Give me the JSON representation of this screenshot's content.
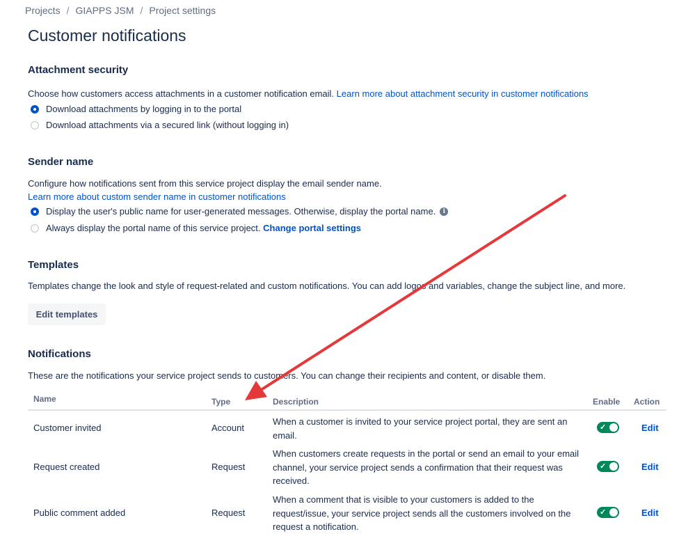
{
  "breadcrumb": {
    "items": [
      "Projects",
      "GIAPPS JSM",
      "Project settings"
    ],
    "separator": "/"
  },
  "page": {
    "title": "Customer notifications"
  },
  "attachment_security": {
    "heading": "Attachment security",
    "description": "Choose how customers access attachments in a customer notification email.",
    "learn_more": "Learn more about attachment security in customer notifications",
    "options": [
      {
        "label": "Download attachments by logging in to the portal",
        "selected": true
      },
      {
        "label": "Download attachments via a secured link (without logging in)",
        "selected": false
      }
    ]
  },
  "sender_name": {
    "heading": "Sender name",
    "description": "Configure how notifications sent from this service project display the email sender name.",
    "learn_more": "Learn more about custom sender name in customer notifications",
    "options": [
      {
        "label": "Display the user's public name for user-generated messages. Otherwise, display the portal name.",
        "selected": true,
        "icon": "info-icon"
      },
      {
        "label": "Always display the portal name of this service project.",
        "link": "Change portal settings",
        "selected": false
      }
    ]
  },
  "templates": {
    "heading": "Templates",
    "description": "Templates change the look and style of request-related and custom notifications. You can add logos and variables, change the subject line, and more.",
    "button": "Edit templates"
  },
  "notifications": {
    "heading": "Notifications",
    "description": "These are the notifications your service project sends to customers. You can change their recipients and content, or disable them.",
    "columns": {
      "name": "Name",
      "type": "Type",
      "description": "Description",
      "enable": "Enable",
      "action": "Action"
    },
    "rows": [
      {
        "name": "Customer invited",
        "type": "Account",
        "description": "When a customer is invited to your service project portal, they are sent an email.",
        "enabled": true,
        "action": "Edit"
      },
      {
        "name": "Request created",
        "type": "Request",
        "description": "When customers create requests in the portal or send an email to your email channel, your service project sends a confirmation that their request was received.",
        "enabled": true,
        "action": "Edit"
      },
      {
        "name": "Public comment added",
        "type": "Request",
        "description": "When a comment that is visible to your customers is added to the request/issue, your service project sends all the customers involved on the request a notification.",
        "enabled": true,
        "action": "Edit"
      }
    ]
  },
  "annotation": {
    "color": "#e5383b"
  },
  "colors": {
    "link": "#0052cc",
    "toggle_on": "#00875a",
    "text": "#172b4d"
  }
}
